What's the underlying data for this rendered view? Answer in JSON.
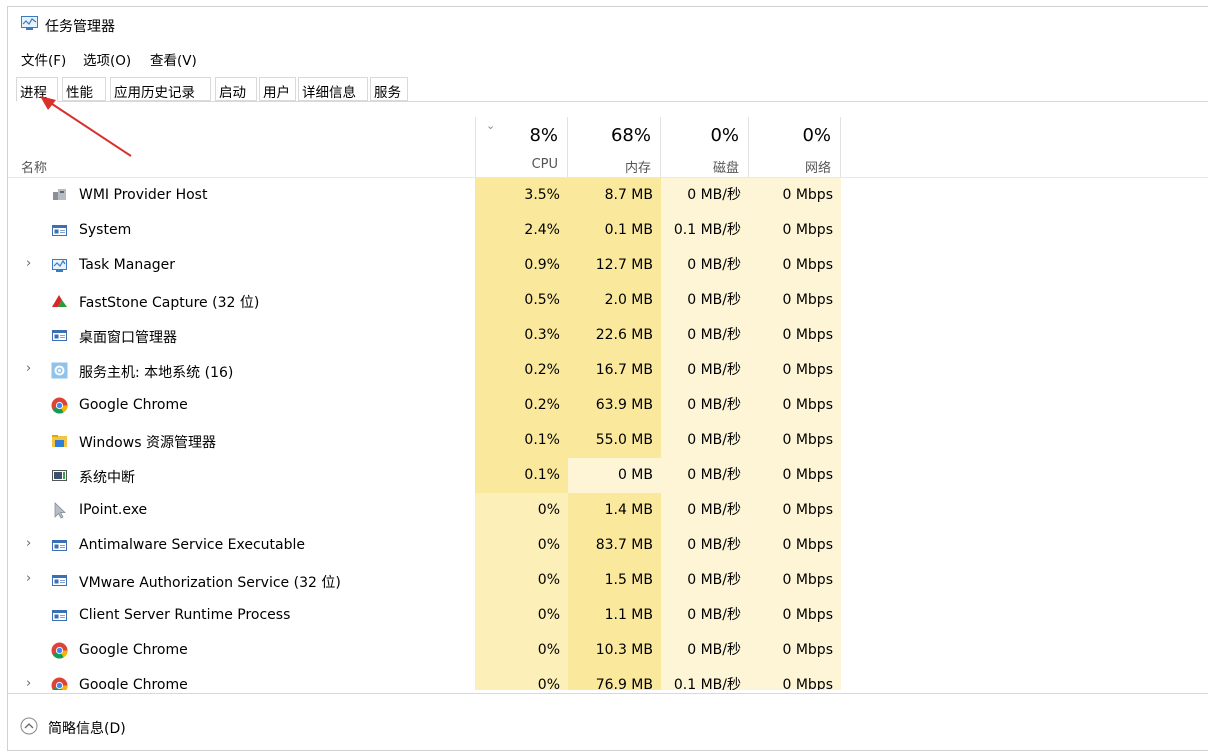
{
  "window": {
    "title": "任务管理器"
  },
  "menu": [
    "文件(F)",
    "选项(O)",
    "查看(V)"
  ],
  "tabs": [
    "进程",
    "性能",
    "应用历史记录",
    "启动",
    "用户",
    "详细信息",
    "服务"
  ],
  "active_tab": "进程",
  "columns": {
    "name_label": "名称",
    "cpu": {
      "percent": "8%",
      "label": "CPU"
    },
    "memory": {
      "percent": "68%",
      "label": "内存"
    },
    "disk": {
      "percent": "0%",
      "label": "磁盘"
    },
    "network": {
      "percent": "0%",
      "label": "网络"
    }
  },
  "processes": [
    {
      "name": "WMI Provider Host",
      "icon": "wmi-icon",
      "expandable": false,
      "cpu": "3.5%",
      "memory": "8.7 MB",
      "disk": "0 MB/秒",
      "network": "0 Mbps"
    },
    {
      "name": "System",
      "icon": "window-app-icon",
      "expandable": false,
      "cpu": "2.4%",
      "memory": "0.1 MB",
      "disk": "0.1 MB/秒",
      "network": "0 Mbps"
    },
    {
      "name": "Task Manager",
      "icon": "task-manager-icon",
      "expandable": true,
      "cpu": "0.9%",
      "memory": "12.7 MB",
      "disk": "0 MB/秒",
      "network": "0 Mbps"
    },
    {
      "name": "FastStone Capture (32 位)",
      "icon": "faststone-icon",
      "expandable": false,
      "cpu": "0.5%",
      "memory": "2.0 MB",
      "disk": "0 MB/秒",
      "network": "0 Mbps"
    },
    {
      "name": "桌面窗口管理器",
      "icon": "window-app-icon",
      "expandable": false,
      "cpu": "0.3%",
      "memory": "22.6 MB",
      "disk": "0 MB/秒",
      "network": "0 Mbps"
    },
    {
      "name": "服务主机: 本地系统 (16)",
      "icon": "gear-icon",
      "expandable": true,
      "cpu": "0.2%",
      "memory": "16.7 MB",
      "disk": "0 MB/秒",
      "network": "0 Mbps"
    },
    {
      "name": "Google Chrome",
      "icon": "chrome-icon",
      "expandable": false,
      "cpu": "0.2%",
      "memory": "63.9 MB",
      "disk": "0 MB/秒",
      "network": "0 Mbps"
    },
    {
      "name": "Windows 资源管理器",
      "icon": "folder-icon",
      "expandable": false,
      "cpu": "0.1%",
      "memory": "55.0 MB",
      "disk": "0 MB/秒",
      "network": "0 Mbps"
    },
    {
      "name": "系统中断",
      "icon": "interrupt-icon",
      "expandable": false,
      "cpu": "0.1%",
      "memory": "0 MB",
      "disk": "0 MB/秒",
      "network": "0 Mbps"
    },
    {
      "name": "IPoint.exe",
      "icon": "pointer-icon",
      "expandable": false,
      "cpu": "0%",
      "memory": "1.4 MB",
      "disk": "0 MB/秒",
      "network": "0 Mbps"
    },
    {
      "name": "Antimalware Service Executable",
      "icon": "window-app-icon",
      "expandable": true,
      "cpu": "0%",
      "memory": "83.7 MB",
      "disk": "0 MB/秒",
      "network": "0 Mbps"
    },
    {
      "name": "VMware Authorization Service (32 位)",
      "icon": "window-app-icon",
      "expandable": true,
      "cpu": "0%",
      "memory": "1.5 MB",
      "disk": "0 MB/秒",
      "network": "0 Mbps"
    },
    {
      "name": "Client Server Runtime Process",
      "icon": "window-app-icon",
      "expandable": false,
      "cpu": "0%",
      "memory": "1.1 MB",
      "disk": "0 MB/秒",
      "network": "0 Mbps"
    },
    {
      "name": "Google Chrome",
      "icon": "chrome-icon",
      "expandable": false,
      "cpu": "0%",
      "memory": "10.3 MB",
      "disk": "0 MB/秒",
      "network": "0 Mbps"
    },
    {
      "name": "Google Chrome",
      "icon": "chrome-icon",
      "expandable": true,
      "cpu": "0%",
      "memory": "76.9 MB",
      "disk": "0.1 MB/秒",
      "network": "0 Mbps"
    }
  ],
  "footer": {
    "label": "简略信息(D)"
  },
  "colors": {
    "heat_strong": "#fae89c",
    "heat_medium": "#fcefb8",
    "heat_light": "#fdf5d6",
    "annotation_arrow": "#d9302c"
  }
}
